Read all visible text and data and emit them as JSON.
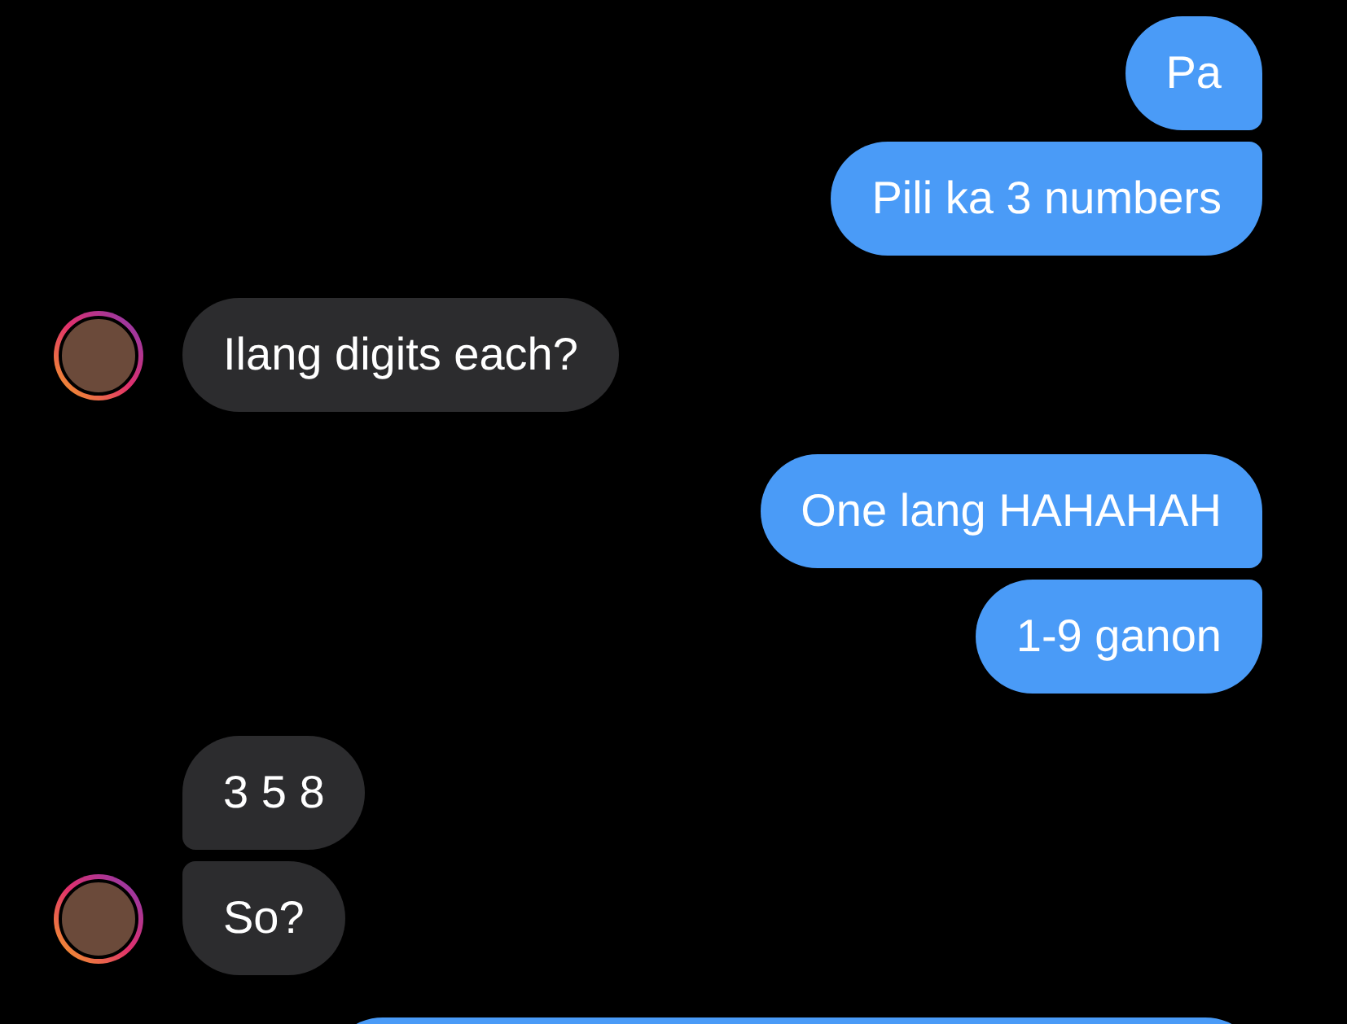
{
  "groups": [
    {
      "kind": "sent",
      "messages": [
        {
          "kind": "text",
          "text": "Pa"
        },
        {
          "kind": "text",
          "text": "Pili ka 3 numbers"
        }
      ]
    },
    {
      "kind": "received",
      "messages": [
        {
          "kind": "text",
          "text": "Ilang digits each?"
        }
      ]
    },
    {
      "kind": "sent",
      "messages": [
        {
          "kind": "text",
          "text": "One lang HAHAHAH"
        },
        {
          "kind": "text",
          "text": "1-9 ganon"
        }
      ]
    },
    {
      "kind": "received",
      "messages": [
        {
          "kind": "text",
          "text": "3 5 8"
        },
        {
          "kind": "text",
          "text": "So?"
        }
      ]
    },
    {
      "kind": "sent",
      "messages": [
        {
          "kind": "cut"
        }
      ]
    }
  ]
}
